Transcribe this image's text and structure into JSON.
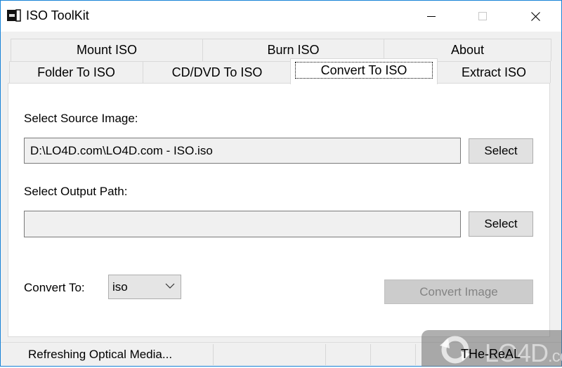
{
  "window": {
    "title": "ISO ToolKit",
    "icon": "iso-toolkit-app-icon",
    "controls": {
      "minimize": "minimize-icon",
      "maximize": "maximize-icon",
      "close": "close-icon"
    }
  },
  "tabs": {
    "row1": [
      {
        "label": "Mount ISO"
      },
      {
        "label": "Burn ISO"
      },
      {
        "label": "About"
      }
    ],
    "row2": [
      {
        "label": "Folder To ISO"
      },
      {
        "label": "CD/DVD To ISO"
      },
      {
        "label": "Convert To ISO",
        "active": true
      },
      {
        "label": "Extract ISO"
      }
    ]
  },
  "convert_panel": {
    "source_label": "Select Source Image:",
    "source_value": "D:\\LO4D.com\\LO4D.com - ISO.iso",
    "source_button": "Select",
    "output_label": "Select Output Path:",
    "output_value": "",
    "output_button": "Select",
    "convert_to_label": "Convert To:",
    "convert_to_selected": "iso",
    "convert_button": "Convert Image",
    "convert_button_enabled": false
  },
  "statusbar": {
    "status_text": "Refreshing Optical Media...",
    "right_text": "THe-ReAL"
  },
  "watermark": {
    "brand": "LO4D",
    "suffix": ".com"
  }
}
